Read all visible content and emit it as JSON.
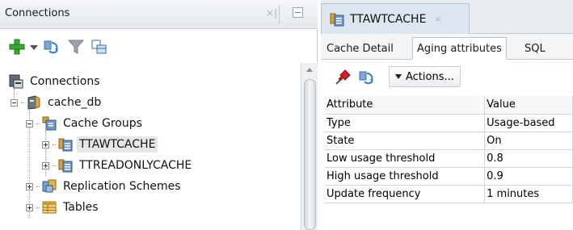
{
  "left_panel": {
    "title": "Connections",
    "close_glyph": "×|",
    "toolbar": {
      "icons": [
        "plus-icon",
        "chevron-down-icon",
        "refresh-icon",
        "filter-icon",
        "cache-group-icon"
      ]
    },
    "tree": [
      {
        "label": "Connections",
        "icon": "connections-icon"
      },
      {
        "label": "cache_db",
        "icon": "database-icon",
        "expanded": true
      },
      {
        "label": "Cache Groups",
        "icon": "cache-groups-icon",
        "expanded": true
      },
      {
        "label": "TTAWTCACHE",
        "icon": "cache-group-icon",
        "selected": true
      },
      {
        "label": "TTREADONLYCACHE",
        "icon": "cache-group-icon"
      },
      {
        "label": "Replication Schemes",
        "icon": "replication-icon"
      },
      {
        "label": "Tables",
        "icon": "table-icon"
      }
    ]
  },
  "right_panel": {
    "doc_tab": {
      "label": "TTAWTCACHE",
      "close_glyph": "×"
    },
    "sub_tabs": [
      {
        "label": "Cache Detail",
        "active": false
      },
      {
        "label": "Aging attributes",
        "active": true
      },
      {
        "label": "SQL",
        "active": false
      }
    ],
    "actions_label": "Actions...",
    "table": {
      "columns": [
        "Attribute",
        "Value"
      ],
      "rows": [
        [
          "Type",
          "Usage-based"
        ],
        [
          "State",
          "On"
        ],
        [
          "Low usage threshold",
          "0.8"
        ],
        [
          "High usage threshold",
          "0.9"
        ],
        [
          "Update frequency",
          "1 minutes"
        ]
      ]
    }
  },
  "colors": {
    "accent_green": "#3aa635",
    "pin_red": "#d0212b",
    "selection": "#e6e6e6"
  }
}
